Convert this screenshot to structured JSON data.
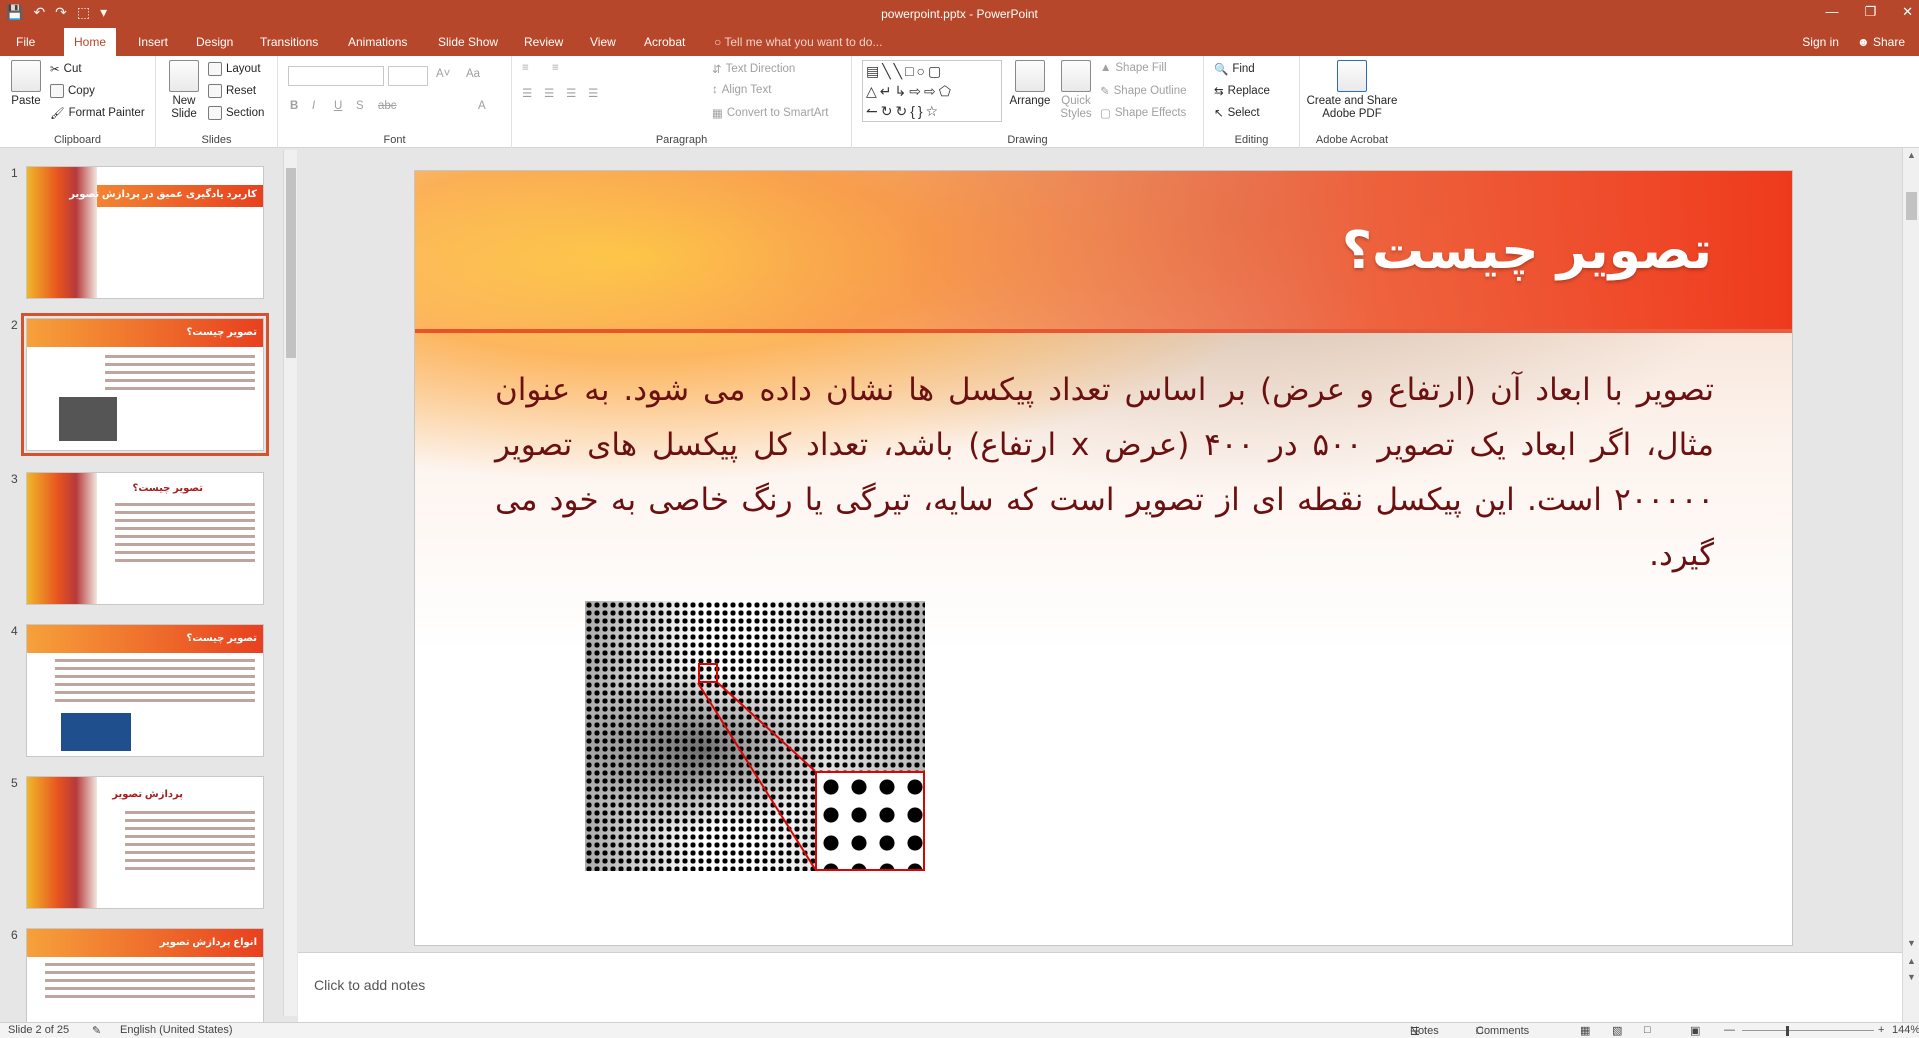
{
  "window": {
    "title": "powerpoint.pptx - PowerPoint",
    "controls": [
      "―",
      "❐",
      "✕"
    ],
    "qat": [
      "💾",
      "↶",
      "↷",
      "⬚",
      "▾"
    ]
  },
  "tabs": {
    "items": [
      "File",
      "Home",
      "Insert",
      "Design",
      "Transitions",
      "Animations",
      "Slide Show",
      "Review",
      "View",
      "Acrobat"
    ],
    "active": "Home",
    "tell_me": "Tell me what you want to do...",
    "sign_in": "Sign in",
    "share": "Share"
  },
  "ribbon": {
    "clipboard": {
      "paste": "Paste",
      "cut": "Cut",
      "copy": "Copy",
      "format_painter": "Format Painter",
      "label": "Clipboard"
    },
    "slides": {
      "new_slide_1": "New",
      "new_slide_2": "Slide",
      "layout": "Layout",
      "reset": "Reset",
      "section": "Section",
      "label": "Slides"
    },
    "font": {
      "label": "Font",
      "buttons": [
        "B",
        "I",
        "U",
        "S",
        "abc",
        "A˅",
        "Aa",
        "A"
      ]
    },
    "paragraph": {
      "text_direction": "Text Direction",
      "align_text": "Align Text",
      "convert_smartart": "Convert to SmartArt",
      "label": "Paragraph"
    },
    "drawing": {
      "arrange": "Arrange",
      "quick_styles_1": "Quick",
      "quick_styles_2": "Styles",
      "shape_fill": "Shape Fill",
      "shape_outline": "Shape Outline",
      "shape_effects": "Shape Effects",
      "label": "Drawing"
    },
    "editing": {
      "find": "Find",
      "replace": "Replace",
      "select": "Select",
      "label": "Editing"
    },
    "acrobat": {
      "create_1": "Create and Share",
      "create_2": "Adobe PDF",
      "label": "Adobe Acrobat"
    }
  },
  "thumbnails": [
    {
      "num": "1",
      "title": "کاربرد یادگیری عمیق در پردازش تصویر"
    },
    {
      "num": "2",
      "title": "تصویر چیست؟"
    },
    {
      "num": "3",
      "title": "تصویر چیست؟"
    },
    {
      "num": "4",
      "title": "تصویر چیست؟"
    },
    {
      "num": "5",
      "title": "پردازش تصویر"
    },
    {
      "num": "6",
      "title": "انواع پردازش تصویر"
    }
  ],
  "slide": {
    "title": "تصویر چیست؟",
    "body": "تصویر با ابعاد آن (ارتفاع و عرض) بر اساس تعداد پیکسل ها نشان داده می شود. به عنوان مثال، اگر ابعاد یک تصویر ۵۰۰ در ۴۰۰ (عرض x ارتفاع) باشد، تعداد کل پیکسل های تصویر ۲۰۰۰۰۰ است. این پیکسل نقطه ای از تصویر است که سایه، تیرگی یا رنگ خاصی به خود می گیرد."
  },
  "notes": {
    "placeholder": "Click to add notes"
  },
  "status": {
    "slide": "Slide 2 of 25",
    "language": "English (United States)",
    "notes": "Notes",
    "comments": "Comments",
    "zoom": "144%"
  },
  "colors": {
    "accent": "#b7472a",
    "title_band": "#ee3a1c",
    "body_text": "#6b1010"
  }
}
